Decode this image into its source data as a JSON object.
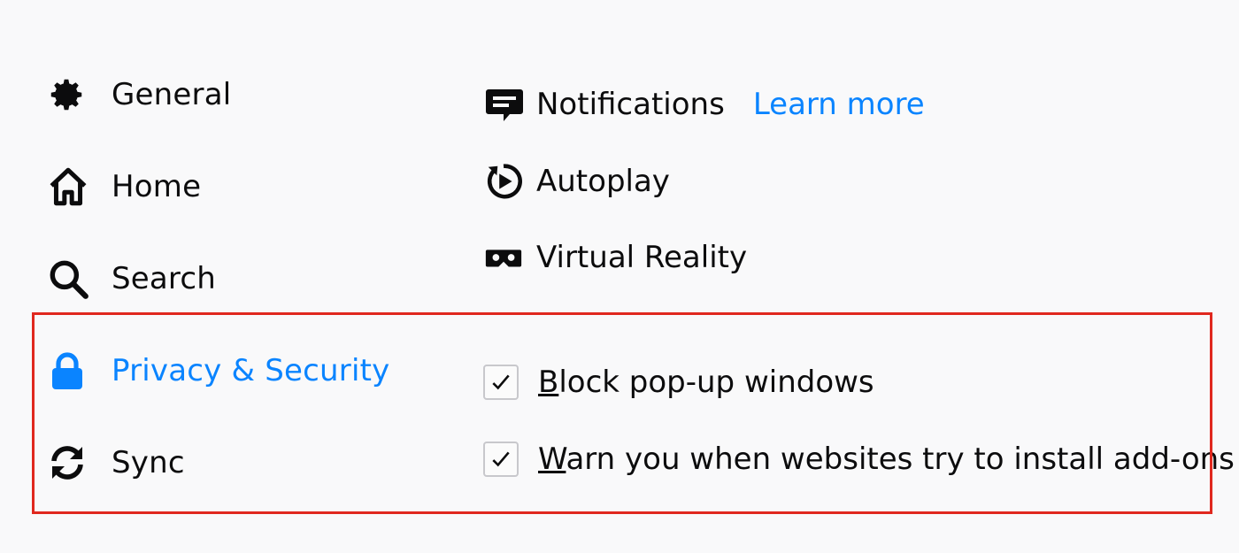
{
  "sidebar": {
    "items": [
      {
        "label": "General",
        "icon": "gear-icon",
        "selected": false
      },
      {
        "label": "Home",
        "icon": "home-icon",
        "selected": false
      },
      {
        "label": "Search",
        "icon": "search-icon",
        "selected": false
      },
      {
        "label": "Privacy & Security",
        "icon": "lock-icon",
        "selected": true
      },
      {
        "label": "Sync",
        "icon": "sync-icon",
        "selected": false
      }
    ]
  },
  "permissions": {
    "notifications": {
      "label": "Notifications",
      "icon": "notification-icon",
      "learn_more": "Learn more"
    },
    "autoplay": {
      "label": "Autoplay",
      "icon": "autoplay-icon"
    },
    "virtual_reality": {
      "label": "Virtual Reality",
      "icon": "vr-headset-icon"
    }
  },
  "options": {
    "block_popups": {
      "label": "Block pop-up windows",
      "checked": true,
      "access_key": "B"
    },
    "warn_addons": {
      "label": "Warn you when websites try to install add-ons",
      "checked": true,
      "access_key": "W"
    }
  },
  "colors": {
    "accent": "#0a84ff",
    "text": "#0c0c0d",
    "highlight_border": "#e0281e",
    "background": "#f9f9fa"
  }
}
